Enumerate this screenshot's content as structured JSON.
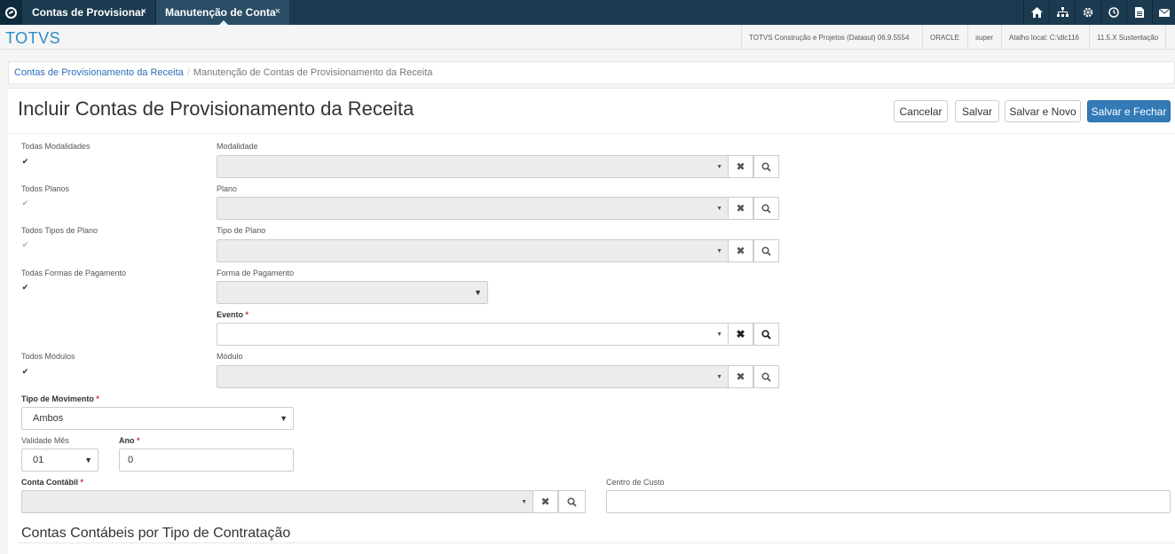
{
  "tabs": [
    {
      "label": "Contas de Provisionar",
      "close": "×"
    },
    {
      "label": "Manutenção de Conta",
      "close": "×"
    }
  ],
  "top_icons": [
    "home-icon",
    "sitemap-icon",
    "gear-icon",
    "clock-icon",
    "document-icon",
    "mail-icon"
  ],
  "header": {
    "brand": "TOTVS",
    "info": [
      "TOTVS Construção e Projetos (Datasul) 06.9.5554",
      "ORACLE",
      "super",
      "Atalho local: C:\\dlc116",
      "11.5.X Sustentação"
    ]
  },
  "breadcrumb": {
    "link": "Contas de Provisionamento da Receita",
    "separator": "/",
    "current": "Manutenção de Contas de Provisionamento da Receita"
  },
  "page": {
    "title": "Incluir Contas de Provisionamento da Receita",
    "buttons": {
      "cancel": "Cancelar",
      "save": "Salvar",
      "save_new": "Salvar e Novo",
      "save_close": "Salvar e Fechar"
    }
  },
  "form": {
    "all_modalities": {
      "label": "Todas Modalidades",
      "checked": true
    },
    "modality": {
      "label": "Modalidade",
      "value": ""
    },
    "all_plans": {
      "label": "Todos Planos",
      "checked": true
    },
    "plan": {
      "label": "Plano",
      "value": ""
    },
    "all_plan_types": {
      "label": "Todos Tipos de Plano",
      "checked": true
    },
    "plan_type": {
      "label": "Tipo de Plano",
      "value": ""
    },
    "all_payment_forms": {
      "label": "Todas Formas de Pagamento",
      "checked": true
    },
    "payment_form": {
      "label": "Forma de Pagamento",
      "value": ""
    },
    "event": {
      "label": "Evento",
      "required": "*",
      "value": ""
    },
    "all_modules": {
      "label": "Todos Módulos",
      "checked": true
    },
    "module": {
      "label": "Módulo",
      "value": ""
    },
    "movement_type": {
      "label": "Tipo de Movimento",
      "required": "*",
      "value": "Ambos"
    },
    "validity_month": {
      "label": "Validade Mês",
      "value": "01"
    },
    "year": {
      "label": "Ano",
      "required": "*",
      "value": "0"
    },
    "account": {
      "label": "Conta Contábil",
      "required": "*",
      "value": ""
    },
    "cost_center": {
      "label": "Centro de Custo",
      "value": ""
    }
  },
  "section": {
    "title": "Contas Contábeis por Tipo de Contratação"
  },
  "glyphs": {
    "check": "✔",
    "clear": "✖",
    "search": "🔍",
    "caret": "▼"
  },
  "colors": {
    "topbar": "#1c3b50",
    "active_tab": "#2a4d66",
    "brand": "#2d8bc9",
    "primary": "#337ab7",
    "required": "#c9302c"
  }
}
